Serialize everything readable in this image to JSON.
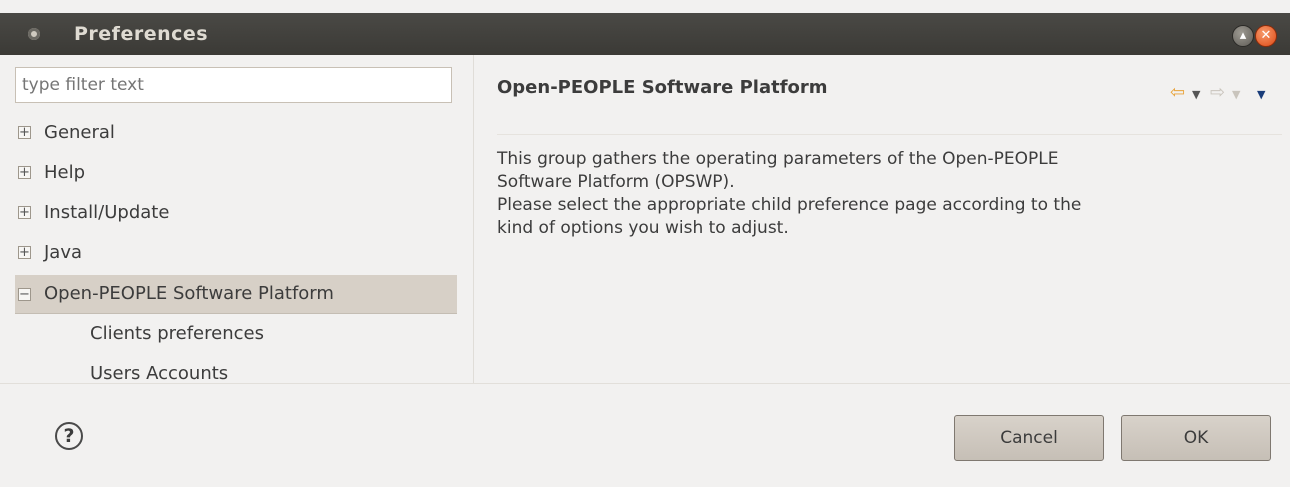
{
  "window": {
    "title": "Preferences"
  },
  "filter": {
    "placeholder": "type filter text"
  },
  "tree": {
    "items": [
      {
        "label": "General",
        "expander": "+"
      },
      {
        "label": "Help",
        "expander": "+"
      },
      {
        "label": "Install/Update",
        "expander": "+"
      },
      {
        "label": "Java",
        "expander": "+"
      },
      {
        "label": "Open-PEOPLE Software Platform",
        "expander": "−"
      },
      {
        "label": "Clients preferences"
      },
      {
        "label": "Users Accounts"
      }
    ]
  },
  "page": {
    "title": "Open-PEOPLE Software Platform",
    "description_lines": [
      "This group gathers the operating parameters of the Open-PEOPLE",
      "Software Platform (OPSWP).",
      "Please select the appropriate child preference page according to the",
      "kind of options you wish to adjust."
    ]
  },
  "buttons": {
    "help": "?",
    "cancel": "Cancel",
    "ok": "OK"
  },
  "icons": {
    "back": "back-arrow-icon",
    "forward": "forward-arrow-icon",
    "menu": "view-menu-icon",
    "close": "close-icon",
    "maximize": "maximize-icon"
  },
  "colors": {
    "titlebar": "#3c3b37",
    "selection": "#d7d0c7",
    "close_button": "#dd4814",
    "back_arrow": "#e8a33b"
  }
}
